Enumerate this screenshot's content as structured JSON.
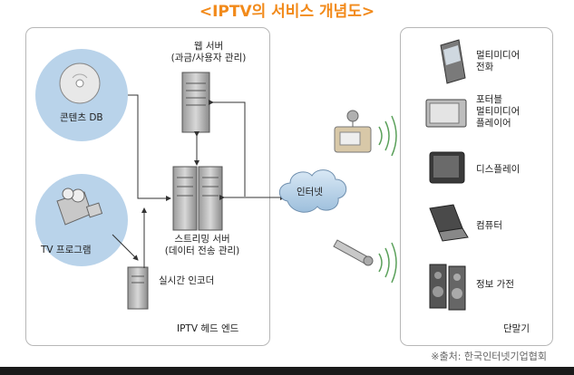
{
  "title": "<IPTV의 서비스 개념도>",
  "head_end": {
    "label": "IPTV 헤드 엔드",
    "web_server_line1": "웹 서버",
    "web_server_line2": "(과금/사용자 관리)",
    "content_db": "콘텐츠 DB",
    "tv_program": "TV 프로그램",
    "streaming_line1": "스트리밍 서버",
    "streaming_line2": "(데이터 전송 관리)",
    "encoder": "실시간 인코더"
  },
  "network": {
    "label": "인터넷"
  },
  "terminals": {
    "label": "단말기",
    "items": [
      {
        "line1": "멀티미디어",
        "line2": "전화",
        "icon": "mobile-phone-icon"
      },
      {
        "line1": "포터블",
        "line2": "멀티미디어",
        "line3": "플레이어",
        "icon": "portable-player-icon"
      },
      {
        "line1": "디스플레이",
        "icon": "tv-display-icon"
      },
      {
        "line1": "컴퓨터",
        "icon": "laptop-icon"
      },
      {
        "line1": "정보 가전",
        "icon": "speaker-icon"
      }
    ]
  },
  "source": "※출처: 한국인터넷기업협회",
  "colors": {
    "title": "#f28a1a",
    "accent_blue": "#b9d3ea",
    "panel_border": "#b7b7b7"
  }
}
